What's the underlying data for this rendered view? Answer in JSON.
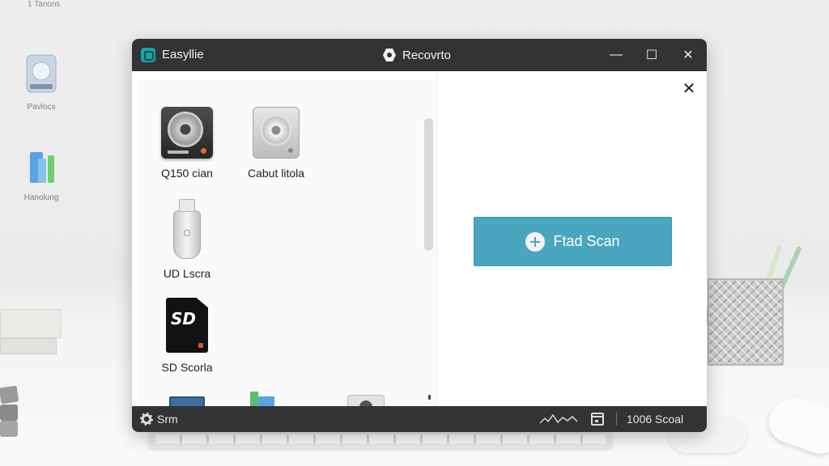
{
  "desktop": {
    "corner_label": "1 Tanons",
    "icons": [
      {
        "label": "Pavlocs",
        "icon": "drive-icon"
      },
      {
        "label": "Hanolung",
        "icon": "files-icon"
      }
    ]
  },
  "window": {
    "app_name": "Easyllie",
    "title": "Recovrto",
    "controls": {
      "minimize": "—",
      "maximize": "☐",
      "close": "✕"
    },
    "pane_close": "✕"
  },
  "drives": [
    {
      "label": "Q150 cian",
      "icon": "hard-drive-icon"
    },
    {
      "label": "Cabut litola",
      "icon": "external-drive-icon"
    },
    {
      "label": "UD Lscra",
      "icon": "usb-drive-icon"
    },
    {
      "label": "SD Scorla",
      "icon": "sd-card-icon",
      "badge": "SD"
    }
  ],
  "scan_button": {
    "label": "Ftad Scan",
    "icon": "plus-circle-icon"
  },
  "status_bar": {
    "left_text": "Srm",
    "right_text": "1006 Scoal",
    "icons": [
      "gear-icon",
      "signal-wave-icon",
      "calendar-icon"
    ]
  },
  "colors": {
    "titlebar": "#333333",
    "accent": "#4aa6bf",
    "window_bg": "#ffffff"
  }
}
